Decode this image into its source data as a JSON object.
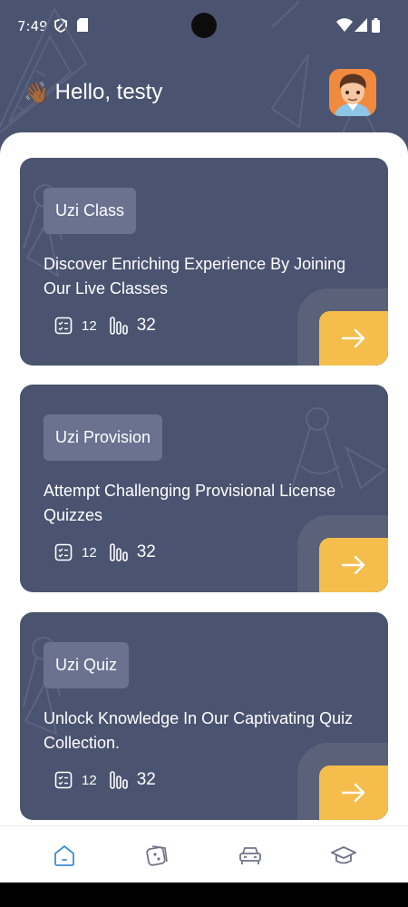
{
  "status_bar": {
    "time": "7:49"
  },
  "header": {
    "wave_emoji": "👋🏾",
    "greeting": "Hello, testy"
  },
  "cards": [
    {
      "tag": "Uzi Class",
      "description": "Discover Enriching Experience By Joining Our Live Classes",
      "stat_questions": "12",
      "stat_count": "32"
    },
    {
      "tag": "Uzi Provision",
      "description": "Attempt Challenging Provisional License Quizzes",
      "stat_questions": "12",
      "stat_count": "32"
    },
    {
      "tag": "Uzi Quiz",
      "description": "Unlock Knowledge In Our Captivating Quiz Collection.",
      "stat_questions": "12",
      "stat_count": "32"
    }
  ],
  "bottom_nav": [
    {
      "icon": "home-icon",
      "active": true
    },
    {
      "icon": "dice-icon",
      "active": false
    },
    {
      "icon": "car-icon",
      "active": false
    },
    {
      "icon": "graduation-cap-icon",
      "active": false
    }
  ],
  "colors": {
    "primary": "#4a5470",
    "accent": "#f5be4c",
    "tag_bg": "#6a7290",
    "nav_active": "#3b8fd6",
    "nav_inactive": "#6f7487"
  }
}
